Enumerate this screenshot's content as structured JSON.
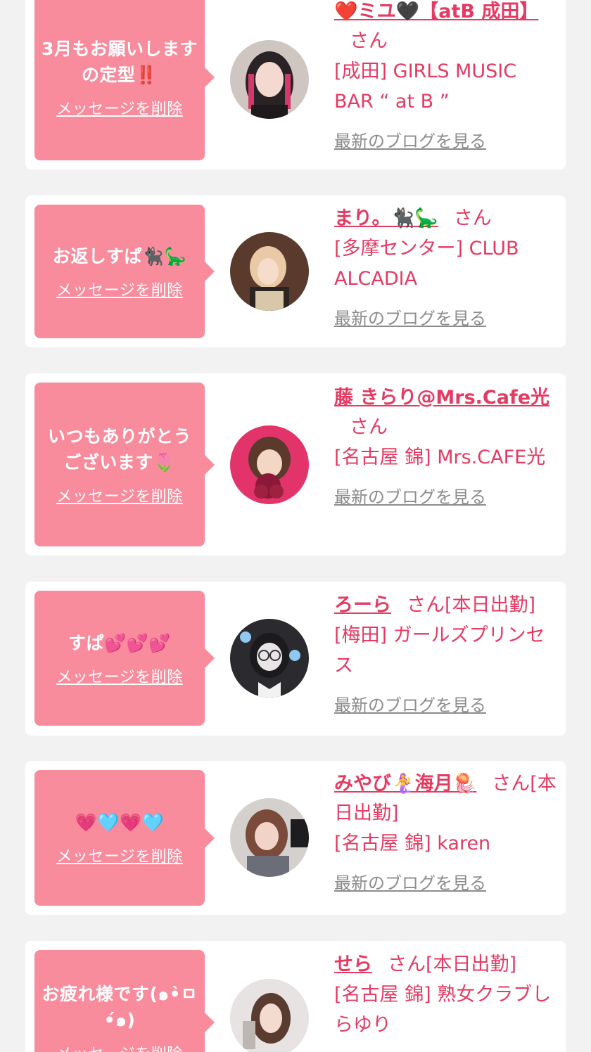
{
  "delete_label": "メッセージを削除",
  "blog_label": "最新のブログを見る",
  "honorific": "さん",
  "colors": {
    "background": "#f2f2f2",
    "card": "#ffffff",
    "bubble": "#f88b9c",
    "accent": "#e53a62",
    "link_gray": "#8c8c8c"
  },
  "messages": [
    {
      "message": "3月もお願いしますの定型‼️",
      "name": "❤️ミユ🖤【atB 成田】",
      "status": "",
      "shop": "[成田] GIRLS MUSIC BAR “ at B ”",
      "avatar_icon": "avatar-photo-icon"
    },
    {
      "message": "お返しすぱ🐈‍⬛🦕",
      "name": "まり。🐈‍⬛🦕",
      "status": "",
      "shop": "[多摩センター] CLUB ALCADIA",
      "avatar_icon": "avatar-photo-icon"
    },
    {
      "message": "いつもありがとうございます🌷",
      "name": "藤 きらり@Mrs.Cafe光",
      "status": "",
      "shop": "[名古屋 錦] Mrs.CAFE光",
      "avatar_icon": "avatar-photo-icon"
    },
    {
      "message": "すぱ💕💕💕",
      "name": "ろーら",
      "status": "[本日出勤]",
      "shop": "[梅田] ガールズプリンセス",
      "avatar_icon": "avatar-photo-icon"
    },
    {
      "message": "💗🩵💗🩵",
      "name": "みやび🧜‍♀️海月🪼",
      "status": "[本日出勤]",
      "shop": "[名古屋 錦] karen",
      "avatar_icon": "avatar-photo-icon"
    },
    {
      "message": "お疲れ様です(๑•̀ㅁ•́๑)",
      "name": "せら",
      "status": "[本日出勤]",
      "shop": "[名古屋 錦] 熟女クラブしらゆり",
      "avatar_icon": "avatar-photo-icon"
    }
  ]
}
